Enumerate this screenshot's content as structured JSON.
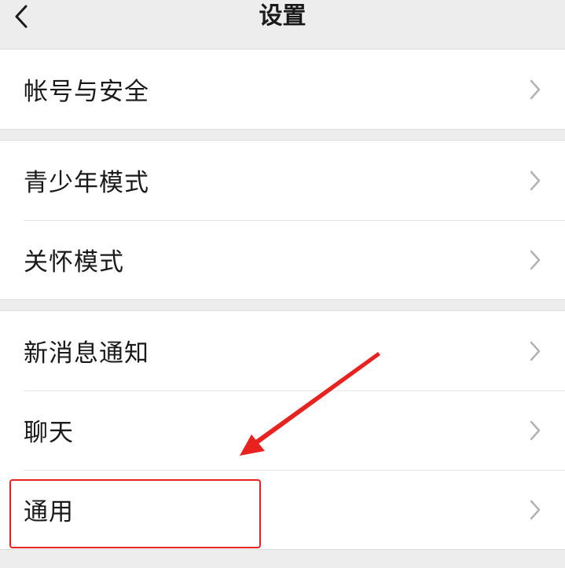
{
  "header": {
    "title": "设置",
    "back_icon": "chevron-left-icon"
  },
  "groups": [
    {
      "items": [
        {
          "label": "帐号与安全"
        }
      ]
    },
    {
      "items": [
        {
          "label": "青少年模式"
        },
        {
          "label": "关怀模式"
        }
      ]
    },
    {
      "items": [
        {
          "label": "新消息通知"
        },
        {
          "label": "聊天"
        },
        {
          "label": "通用"
        }
      ]
    }
  ],
  "row_chevron_icon": "chevron-right-icon",
  "colors": {
    "page_background": "#ededed",
    "row_background": "#ffffff",
    "text": "#1a1a1a",
    "chevron": "#b2b2b2",
    "annotation": "#e8231f"
  },
  "annotation": {
    "highlighted_item": "通用"
  }
}
